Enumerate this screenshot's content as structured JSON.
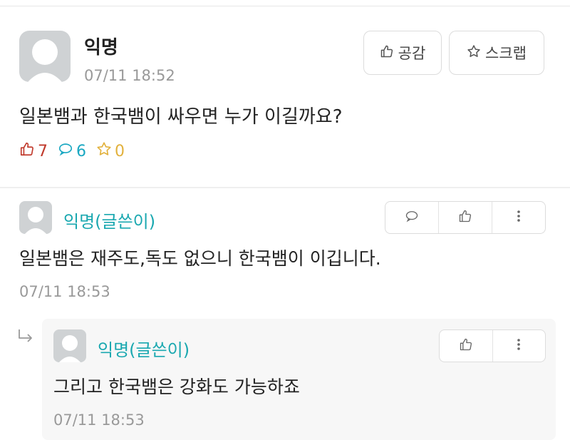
{
  "post": {
    "author": "익명",
    "time": "07/11 18:52",
    "like_button": "공감",
    "scrap_button": "스크랩",
    "body": "일본뱀과 한국뱀이 싸우면 누가 이길까요?",
    "stats": {
      "likes": "7",
      "comments": "6",
      "scraps": "0"
    }
  },
  "comments": [
    {
      "author": "익명(글쓴이)",
      "body": "일본뱀은 재주도,독도 없으니 한국뱀이 이깁니다.",
      "time": "07/11 18:53"
    }
  ],
  "replies": [
    {
      "author": "익명(글쓴이)",
      "body": "그리고 한국뱀은 강화도 가능하죠",
      "time": "07/11 18:53"
    }
  ],
  "icons": {
    "like": "thumbs-up-icon",
    "comment": "speech-bubble-icon",
    "scrap": "star-icon",
    "more": "vertical-dots-icon",
    "reply": "reply-arrow-icon"
  },
  "colors": {
    "author_comment": "#1aa8b0",
    "like_count": "#c0392b",
    "comment_count": "#1aa8c2",
    "scrap_count": "#e2b13c"
  }
}
